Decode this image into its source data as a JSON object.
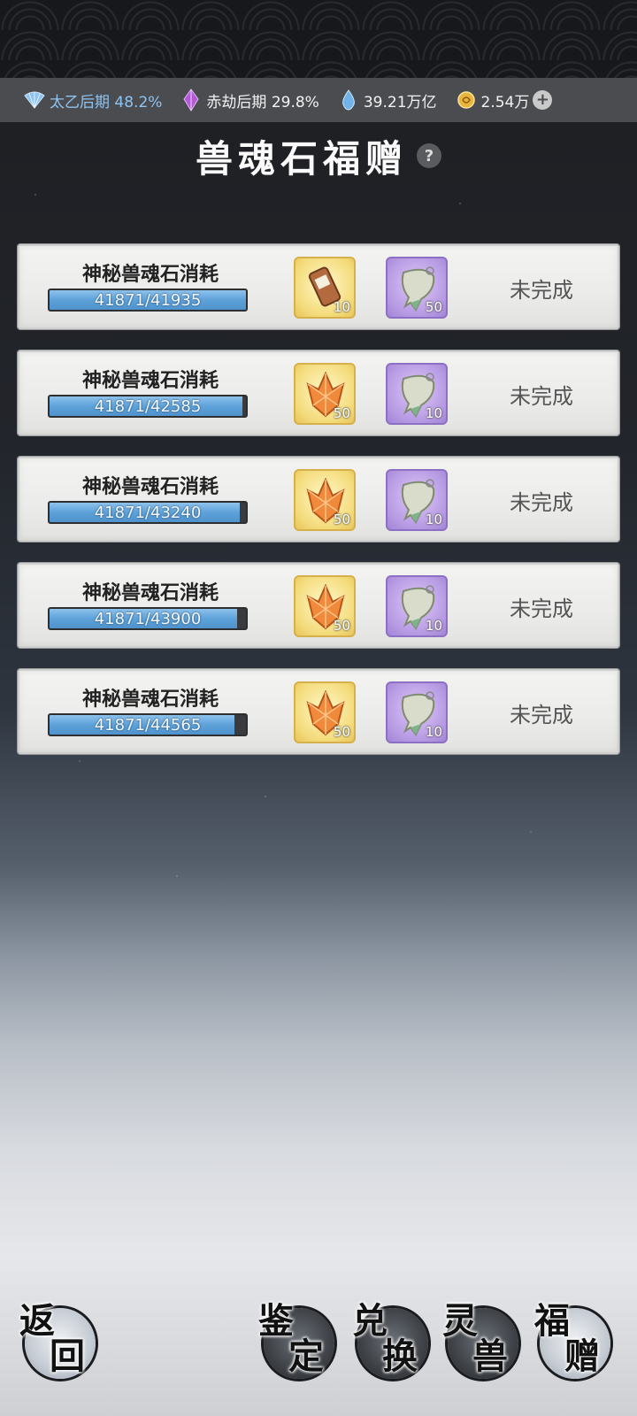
{
  "resources": [
    {
      "icon": "fan-icon",
      "text": "太乙后期 48.2%",
      "color": "#8ec3f2"
    },
    {
      "icon": "purple-crystal-icon",
      "text": "赤劫后期 29.8%",
      "color": "#f2f2f2"
    },
    {
      "icon": "blue-drop-icon",
      "text": "39.21万亿",
      "color": "#f2f2f2"
    },
    {
      "icon": "gold-coin-icon",
      "text": "2.54万",
      "color": "#f2f2f2"
    }
  ],
  "title": "兽魂石福赠",
  "help_icon": "?",
  "add_icon": "+",
  "tasks": [
    {
      "name": "神秘兽魂石消耗",
      "progress": "41871/41935",
      "current": 41871,
      "target": 41935,
      "reward1": {
        "icon": "scroll-icon",
        "qty": "10"
      },
      "reward2": {
        "icon": "fish-pouch-icon",
        "qty": "50"
      },
      "status": "未完成"
    },
    {
      "name": "神秘兽魂石消耗",
      "progress": "41871/42585",
      "current": 41871,
      "target": 42585,
      "reward1": {
        "icon": "orange-crystal-icon",
        "qty": "50"
      },
      "reward2": {
        "icon": "fish-pouch-icon",
        "qty": "10"
      },
      "status": "未完成"
    },
    {
      "name": "神秘兽魂石消耗",
      "progress": "41871/43240",
      "current": 41871,
      "target": 43240,
      "reward1": {
        "icon": "orange-crystal-icon",
        "qty": "50"
      },
      "reward2": {
        "icon": "fish-pouch-icon",
        "qty": "10"
      },
      "status": "未完成"
    },
    {
      "name": "神秘兽魂石消耗",
      "progress": "41871/43900",
      "current": 41871,
      "target": 43900,
      "reward1": {
        "icon": "orange-crystal-icon",
        "qty": "50"
      },
      "reward2": {
        "icon": "fish-pouch-icon",
        "qty": "10"
      },
      "status": "未完成"
    },
    {
      "name": "神秘兽魂石消耗",
      "progress": "41871/44565",
      "current": 41871,
      "target": 44565,
      "reward1": {
        "icon": "orange-crystal-icon",
        "qty": "50"
      },
      "reward2": {
        "icon": "fish-pouch-icon",
        "qty": "10"
      },
      "status": "未完成"
    }
  ],
  "nav": {
    "back": [
      "返",
      "回"
    ],
    "appraise": [
      "鉴",
      "定"
    ],
    "exchange": [
      "兑",
      "换"
    ],
    "spirit_beast": [
      "灵",
      "兽"
    ],
    "blessing": [
      "福",
      "赠"
    ]
  }
}
